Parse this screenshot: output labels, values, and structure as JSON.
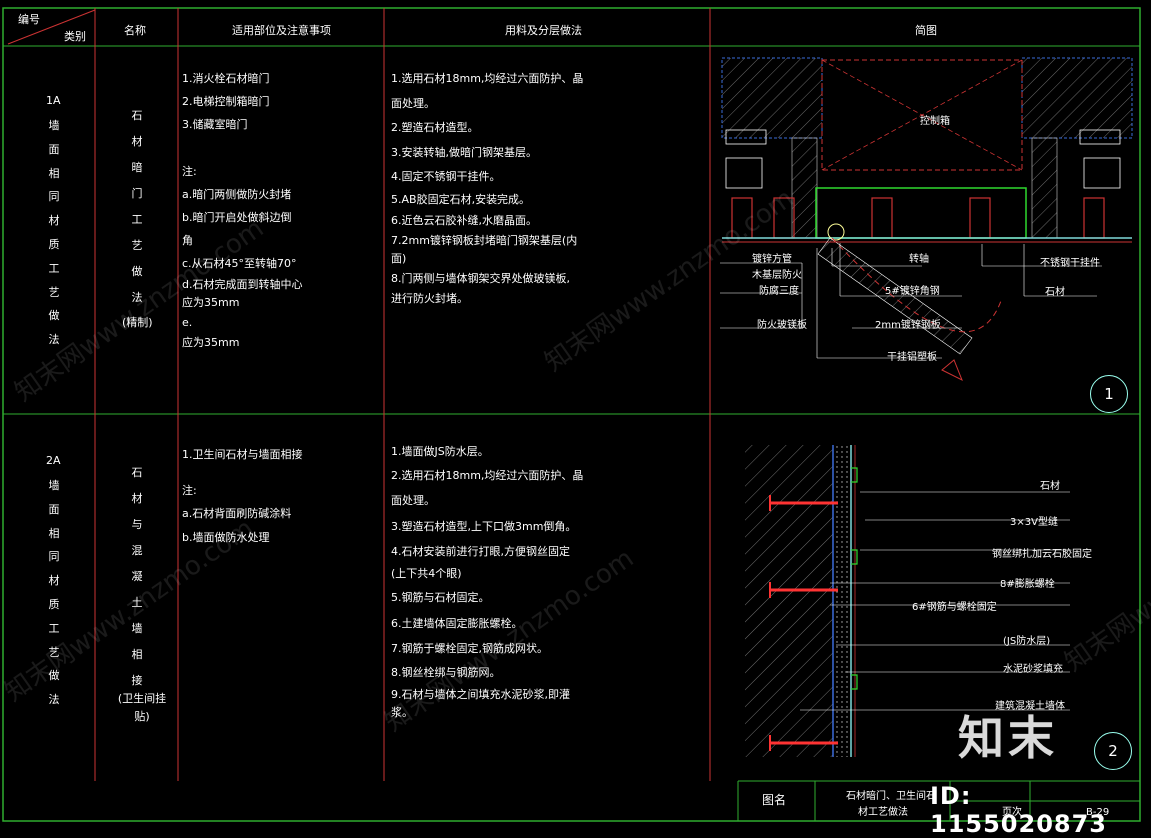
{
  "header": {
    "corner_top": "编号",
    "corner_bottom": "类别",
    "name": "名称",
    "scope": "适用部位及注意事项",
    "method": "用料及分层做法",
    "diagram": "简图"
  },
  "rows": [
    {
      "code": "1A",
      "category": "墙面相同材质工艺做法",
      "name": "石材暗门工艺做法",
      "name_note": "(精制)",
      "scope": [
        "1.消火栓石材暗门",
        "2.电梯控制箱暗门",
        "3.储藏室暗门",
        "",
        "注:",
        "a.暗门两侧做防火封堵",
        "b.暗门开启处做斜边倒",
        "  角",
        "c.从石材45°至转轴70°",
        "d.石材完成面到转轴中心",
        "应为35mm",
        "e.",
        "应为35mm"
      ],
      "method": [
        "1.选用石材18mm,均经过六面防护、晶",
        "   面处理。",
        "2.塑造石材造型。",
        "3.安装转轴,做暗门钢架基层。",
        "4.固定不锈钢干挂件。",
        "5.AB胶固定石材,安装完成。",
        "6.近色云石胶补缝,水磨晶面。",
        "7.2mm镀锌钢板封堵暗门钢架基层(内",
        "   面)",
        "8.门两侧与墙体钢架交界处做玻镁板,",
        "   进行防火封堵。"
      ],
      "diagram_labels": {
        "box": "控制箱",
        "l1": "镀锌方管",
        "l2": "木基层防火",
        "l3": "防腐三度",
        "l4": "防火玻镁板",
        "l5": "转轴",
        "l6": "5#镀锌角钢",
        "l7": "2mm镀锌钢板",
        "l8": "干挂铝塑板",
        "l9": "不锈钢干挂件",
        "l10": "石材"
      },
      "index": "1"
    },
    {
      "code": "2A",
      "category": "墙面相同材质工艺做法",
      "name": "石材与混凝土墙相接",
      "name_note": "(卫生间挂贴)",
      "scope": [
        "1.卫生间石材与墙面相接",
        "",
        "注:",
        "a.石材背面刷防碱涂料",
        "b.墙面做防水处理"
      ],
      "method": [
        "1.墙面做JS防水层。",
        "2.选用石材18mm,均经过六面防护、晶",
        "   面处理。",
        "3.塑造石材造型,上下口做3mm倒角。",
        "4.石材安装前进行打眼,方便钢丝固定",
        "   (上下共4个眼)",
        "5.钢筋与石材固定。",
        "6.土建墙体固定膨胀螺栓。",
        "7.钢筋于螺栓固定,钢筋成网状。",
        "8.钢丝栓绑与钢筋网。",
        "9.石材与墙体之间填充水泥砂浆,即灌",
        "   浆。"
      ],
      "diagram_labels": {
        "l1": "石材",
        "l2": "3×3V型缝",
        "l3": "钢丝绑扎加云石胶固定",
        "l4": "8#膨胀螺栓",
        "l5": "6#钢筋与螺栓固定",
        "l6": "(JS防水层)",
        "l7": "水泥砂浆填充",
        "l8": "建筑混凝土墙体"
      },
      "index": "2"
    }
  ],
  "footer": {
    "drawing_name_label": "图名",
    "drawing_name_1": "石材暗门、卫生间石",
    "drawing_name_2": "材工艺做法",
    "page_label": "页次",
    "page_value": "B-29"
  },
  "watermarks": {
    "site": "知末网www.znzmo.com",
    "logo": "知末",
    "id": "ID: 1155020873"
  },
  "colors": {
    "frame": "#cc3333",
    "border": "#2fae2f",
    "cyan": "#7fd9d9",
    "accent": "#ff3333"
  }
}
